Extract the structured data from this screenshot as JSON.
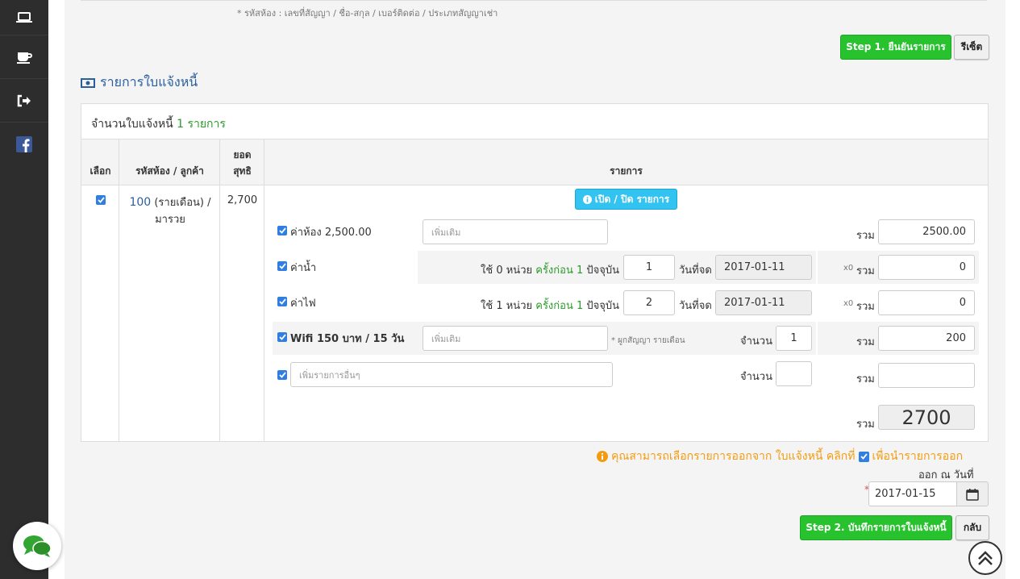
{
  "sidebar": {
    "items": [
      {
        "icon": "laptop-icon"
      },
      {
        "icon": "coffee-icon"
      },
      {
        "icon": "sign-out-icon"
      },
      {
        "icon": "facebook-icon"
      }
    ],
    "chat_icon": "chat-bubbles-icon"
  },
  "header": {
    "hint": "* รหัสห้อง : เลขที่สัญญา / ชื่อ-สกุล / เบอร์ติดต่อ / ประเภทสัญญาเช่า",
    "step1_label": "Step 1. ยืนยันรายการ",
    "reset_label": "รีเซ็ต"
  },
  "section": {
    "title": "รายการใบแจ้งหนี้",
    "count_label": "จำนวนใบแจ้งหนี้",
    "count_value": "1 รายการ"
  },
  "table": {
    "headers": {
      "select": "เลือก",
      "room": "รหัสห้อง / ลูกค้า",
      "net_line1": "ยอด",
      "net_line2": "สุทธิ",
      "items": "รายการ"
    },
    "row": {
      "room_code": "100",
      "room_type": "(รายเดือน) /",
      "customer": "มารวย",
      "net": "2,700",
      "toggle_label": "เปิด / ปิด รายการ",
      "room_fee": {
        "label": "ค่าห้อง 2,500.00",
        "extra_placeholder": "เพิ่มเติม",
        "sum_label": "รวม",
        "sum_value": "2500.00"
      },
      "water": {
        "label": "ค่าน้ำ",
        "use_prefix": "ใช้",
        "use_units": "0",
        "use_unit_label": "หน่วย",
        "prev_label": "ครั้งก่อน",
        "prev_value": "1",
        "current_label": "ปัจจุบัน",
        "current_value": "1",
        "date_label": "วันที่จด",
        "date_value": "2017-01-11",
        "multiplier": "x0",
        "sum_label": "รวม",
        "sum_value": "0"
      },
      "electric": {
        "label": "ค่าไฟ",
        "use_prefix": "ใช้",
        "use_units": "1",
        "use_unit_label": "หน่วย",
        "prev_label": "ครั้งก่อน",
        "prev_value": "1",
        "current_label": "ปัจจุบัน",
        "current_value": "2",
        "date_label": "วันที่จด",
        "date_value": "2017-01-11",
        "multiplier": "x0",
        "sum_label": "รวม",
        "sum_value": "0"
      },
      "wifi": {
        "label": "Wifi 150 บาท / 15 วัน",
        "extra_placeholder": "เพิ่มเติม",
        "note": "* ผูกสัญญา รายเดือน",
        "qty_label": "จำนวน",
        "qty_value": "1",
        "sum_label": "รวม",
        "sum_value": "200"
      },
      "other": {
        "placeholder": "เพิ่มรายการอื่นๆ",
        "qty_label": "จำนวน",
        "qty_value": "",
        "sum_label": "รวม",
        "sum_value": ""
      },
      "total_label": "รวม",
      "total_value": "2700"
    }
  },
  "footer": {
    "notice_prefix": "คุณสามารถเลือกรายการออกจาก ใบแจ้งหนี้ คลิกที่",
    "notice_suffix": "เพื่อนำรายการออก",
    "issue_date_label": "ออก ณ วันที่",
    "required_mark": "*",
    "issue_date_value": "2017-01-15",
    "step2_label": "Step 2. บันทึกรายการใบแจ้งหนี้",
    "back_label": "กลับ"
  },
  "colors": {
    "accent_green": "#27c22d",
    "link_blue": "#2a5f9e",
    "warning_orange": "#f39c12",
    "info_cyan": "#33c3f0",
    "sidebar_bg": "#2d2d2d"
  }
}
